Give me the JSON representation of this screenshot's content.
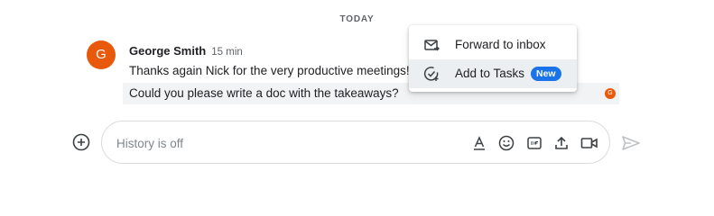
{
  "day_divider": "TODAY",
  "message": {
    "avatar_initial": "G",
    "sender": "George Smith",
    "time": "15 min",
    "lines": [
      "Thanks again Nick for the very productive meetings!",
      "Could you please write a doc with the takeaways?"
    ],
    "read_receipt_initial": "G"
  },
  "context_menu": {
    "items": [
      {
        "label": "Forward to inbox",
        "icon": "forward-to-inbox-icon"
      },
      {
        "label": "Add to Tasks",
        "icon": "add-task-icon",
        "badge": "New"
      }
    ]
  },
  "composer": {
    "placeholder": "History is off",
    "tools": [
      "format-text-icon",
      "emoji-icon",
      "gif-icon",
      "upload-icon",
      "video-meeting-icon"
    ]
  },
  "colors": {
    "avatar": "#e8590c",
    "badge": "#1a73e8",
    "highlight": "#f1f3f4"
  }
}
